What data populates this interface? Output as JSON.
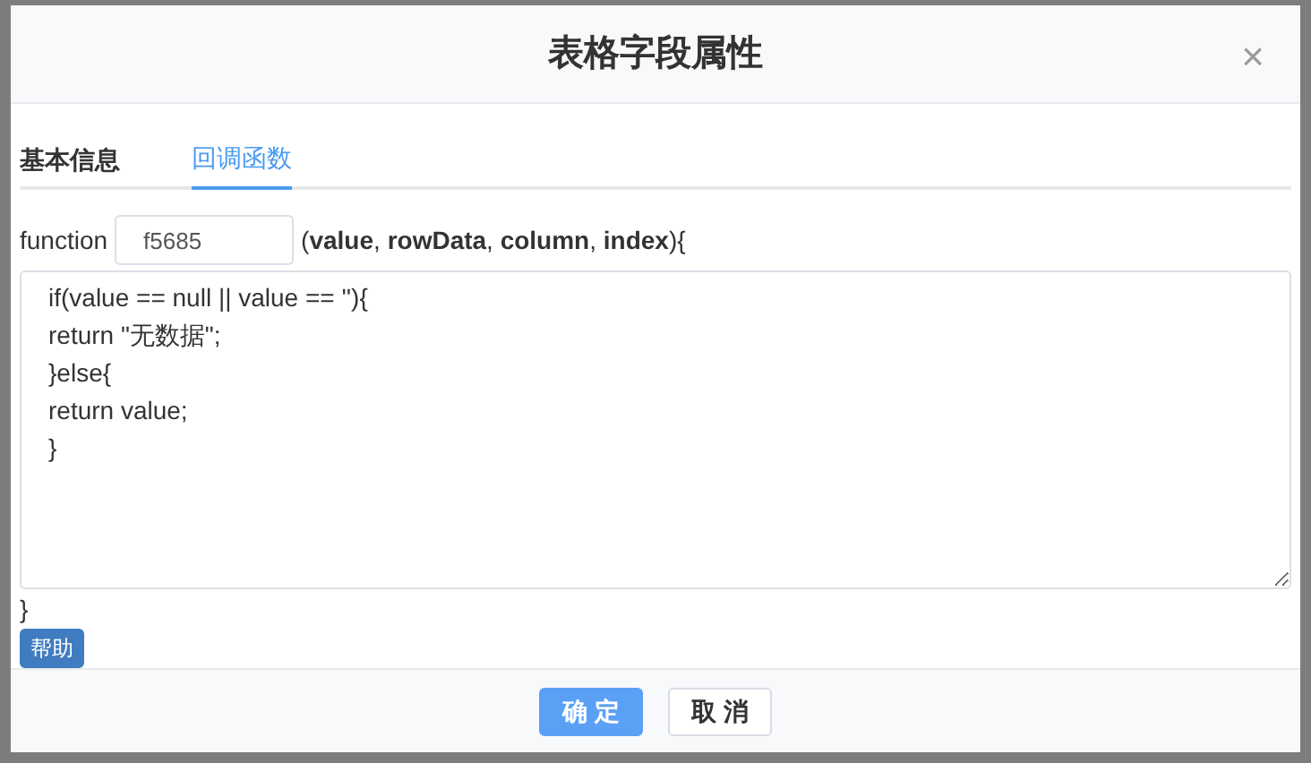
{
  "dialog": {
    "title": "表格字段属性",
    "close": "×"
  },
  "tabs": [
    {
      "label": "基本信息",
      "selected": false
    },
    {
      "label": "回调函数",
      "selected": true
    }
  ],
  "function_row": {
    "keyword": "function",
    "name_field": {
      "value": "f5685"
    },
    "params": "(**value**, **rowData**, **column**, **index**){"
  },
  "code_editor": {
    "value": "if(value == null || value == ''){\nreturn \"无数据\";\n}else{\nreturn value;\n}"
  },
  "closing_brace": "}",
  "help_button": "帮助",
  "buttons": [
    {
      "label": "确 定",
      "kind": "primary"
    },
    {
      "label": "取 消",
      "kind": "secondary"
    }
  ]
}
